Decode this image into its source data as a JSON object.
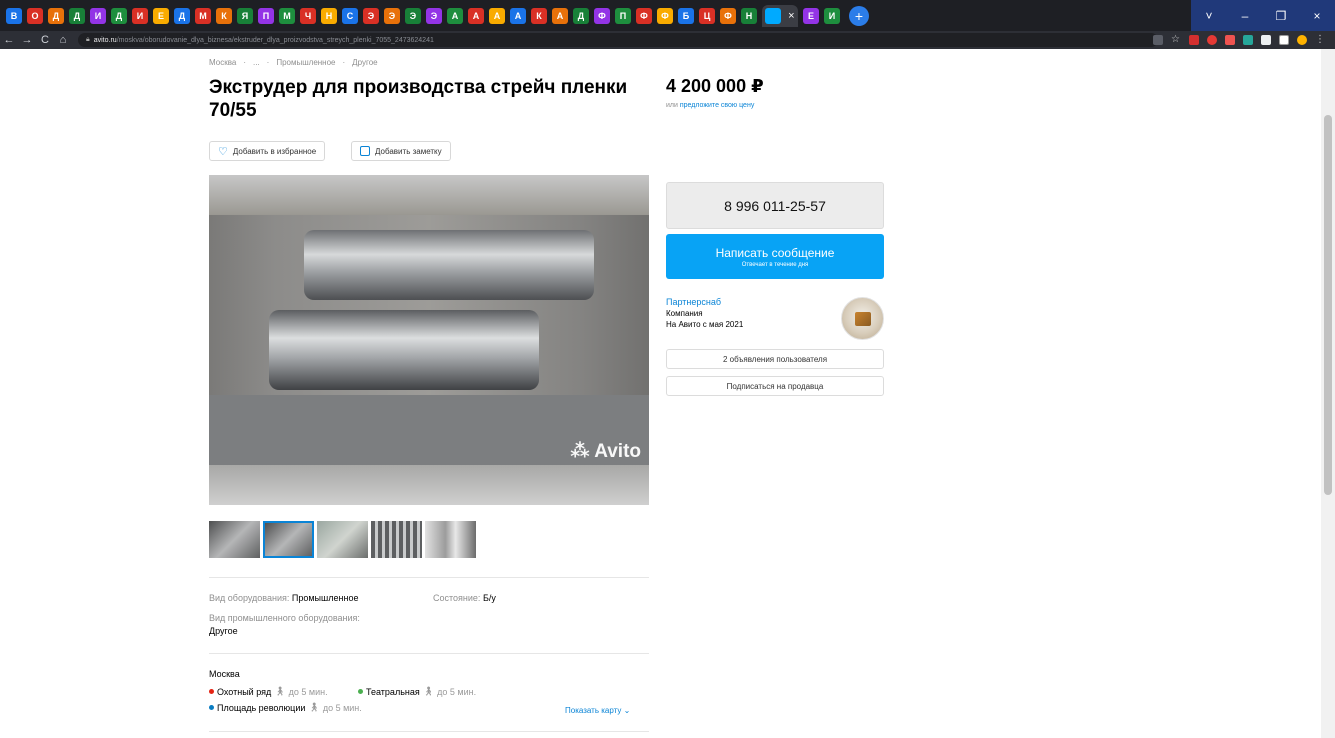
{
  "browser": {
    "tab_letters": [
      "В",
      "О",
      "Д",
      "Д",
      "И",
      "Д",
      "И",
      "Е",
      "Д",
      "М",
      "К",
      "Я",
      "П",
      "М",
      "Ч",
      "Н",
      "С",
      "Э",
      "Э",
      "Э",
      "Э",
      "А",
      "А",
      "А",
      "А",
      "К",
      "А",
      "Д",
      "Ф",
      "П",
      "Ф",
      "Ф",
      "Б",
      "Ц",
      "Ф",
      "Н",
      "Е",
      "И"
    ],
    "active_tab_close": "×",
    "new_tab": "+",
    "url_host": "avito.ru",
    "url_path": "/moskva/oborudovanie_dlya_biznesa/ekstruder_dlya_proizvodstva_streych_plenki_7055_2473624241",
    "window_controls": [
      "˅",
      "–",
      "❐",
      "×"
    ]
  },
  "listing": {
    "breadcrumbs": [
      "Москва",
      "·",
      "...",
      "·",
      "Промышленное",
      "·",
      "Другое"
    ],
    "title": "Экструдер для производства стрейч пленки 70/55",
    "price": "4 200 000 ₽",
    "price_prefix": "или",
    "price_link": "предложите свою цену",
    "favorite_label": "Добавить в избранное",
    "note_label": "Добавить заметку",
    "photo_watermark": "Avito",
    "thumb_count": 5,
    "active_thumb": 1
  },
  "params": {
    "equipment_type_label": "Вид оборудования:",
    "equipment_type_value": "Промышленное",
    "condition_label": "Состояние:",
    "condition_value": "Б/у",
    "industrial_type_label": "Вид промышленного оборудования:",
    "industrial_type_value": "Другое"
  },
  "location": {
    "city": "Москва",
    "metro": [
      {
        "name": "Охотный ряд",
        "walk": "до 5 мин.",
        "color": "#e42313"
      },
      {
        "name": "Театральная",
        "walk": "до 5 мин.",
        "color": "#4baf4f"
      },
      {
        "name": "Площадь революции",
        "walk": "до 5 мин.",
        "color": "#0a7dc2"
      }
    ],
    "show_map": "Показать карту"
  },
  "contact": {
    "phone": "8 996 011-25-57",
    "message_button": "Написать сообщение",
    "message_sub": "Отвечает в течение дня",
    "seller_name": "Партнерснаб",
    "seller_type": "Компания",
    "seller_since": "На Авито с мая 2021",
    "ads_button": "2 объявления пользователя",
    "subscribe_button": "Подписаться на продавца"
  },
  "colors": {
    "accent": "#0a84d6",
    "button": "#08a3f5",
    "chrome": "#1e1f24"
  }
}
